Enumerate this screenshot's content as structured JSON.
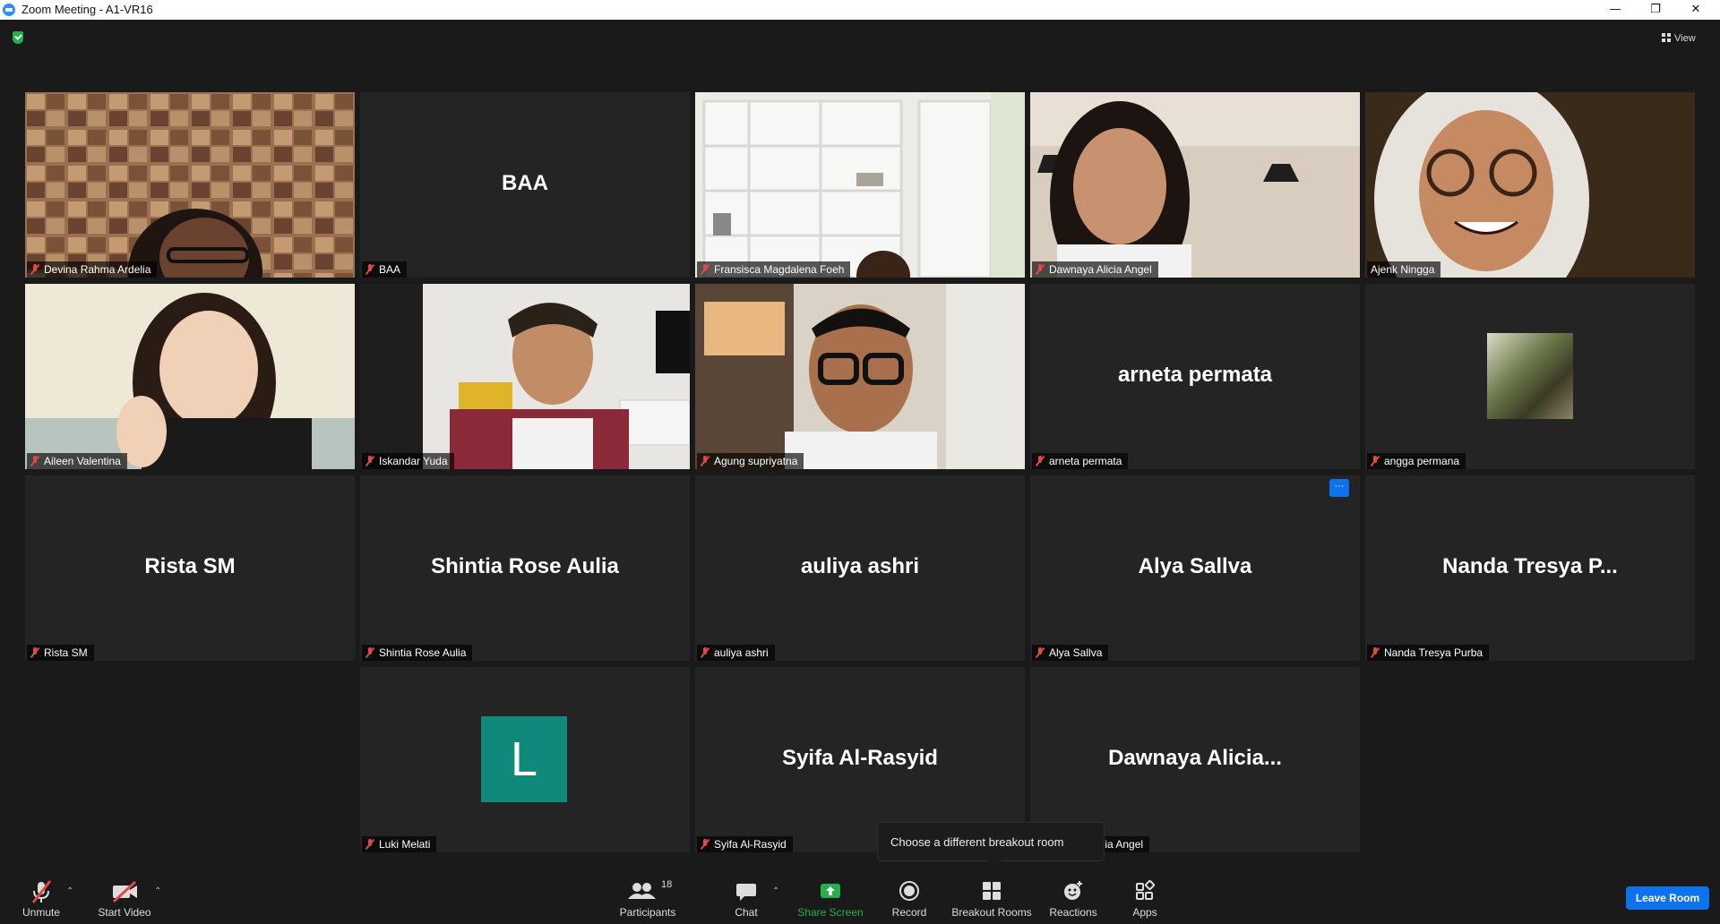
{
  "window": {
    "title": "Zoom Meeting - A1-VR16",
    "minimize": "—",
    "maximize": "❐",
    "close": "✕"
  },
  "header": {
    "view_label": "View"
  },
  "tiles": [
    {
      "big": "",
      "tag": "Devina Rahma Ardelia"
    },
    {
      "big": "BAA",
      "tag": "BAA"
    },
    {
      "big": "",
      "tag": "Fransisca Magdalena Foeh"
    },
    {
      "big": "",
      "tag": "Dawnaya Alicia Angel"
    },
    {
      "big": "",
      "tag": "Ajenk Ningga"
    },
    {
      "big": "",
      "tag": "Aileen Valentina"
    },
    {
      "big": "",
      "tag": "Iskandar Yuda"
    },
    {
      "big": "",
      "tag": "Agung supriyatna"
    },
    {
      "big": "arneta permata",
      "tag": "arneta permata"
    },
    {
      "big": "",
      "tag": "angga permana"
    },
    {
      "big": "Rista SM",
      "tag": "Rista SM"
    },
    {
      "big": "Shintia Rose Aulia",
      "tag": "Shintia Rose Aulia"
    },
    {
      "big": "auliya ashri",
      "tag": "auliya ashri"
    },
    {
      "big": "Alya Sallva",
      "tag": "Alya Sallva",
      "more": "···"
    },
    {
      "big": "Nanda  Tresya  P...",
      "tag": "Nanda Tresya Purba"
    },
    {
      "big": "",
      "tag": "Luki Melati",
      "avatar_letter": "L"
    },
    {
      "big": "Syifa Al-Rasyid",
      "tag": "Syifa Al-Rasyid"
    },
    {
      "big": "Dawnaya  Alicia...",
      "tag": "licia Angel"
    }
  ],
  "tooltip": {
    "text": "Choose a different breakout room"
  },
  "toolbar": {
    "unmute": "Unmute",
    "start_video": "Start Video",
    "participants": "Participants",
    "participants_count": "18",
    "chat": "Chat",
    "share_screen": "Share Screen",
    "record": "Record",
    "breakout_rooms": "Breakout Rooms",
    "reactions": "Reactions",
    "apps": "Apps",
    "caret": "⌃",
    "leave": "Leave Room"
  },
  "colors": {
    "active_speaker_border": "#e6e63c",
    "share_green": "#23b14d",
    "leave_blue": "#0e72ed",
    "muted_red": "#e04848",
    "avatar_teal": "#0f8a7a"
  }
}
